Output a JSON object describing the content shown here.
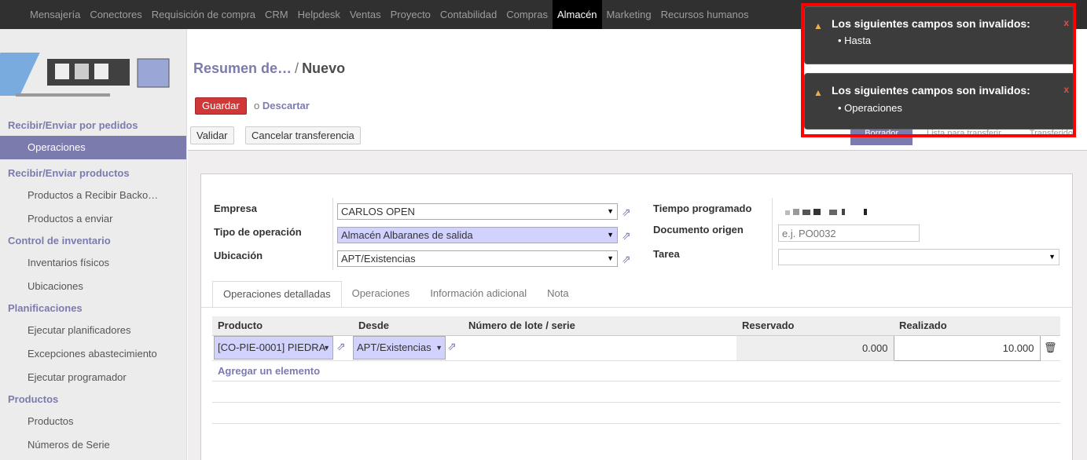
{
  "topbar": {
    "items": [
      "Mensajería",
      "Conectores",
      "Requisición de compra",
      "CRM",
      "Helpdesk",
      "Ventas",
      "Proyecto",
      "Contabilidad",
      "Compras",
      "Almacén",
      "Marketing",
      "Recursos humanos"
    ],
    "active": "Almacén"
  },
  "sidebar": {
    "sections": [
      {
        "title": "Recibir/Enviar por pedidos",
        "items": [
          "Operaciones"
        ]
      },
      {
        "title": "Recibir/Enviar productos",
        "items": [
          "Productos a Recibir Backo…",
          "Productos a enviar"
        ]
      },
      {
        "title": "Control de inventario",
        "items": [
          "Inventarios físicos",
          "Ubicaciones"
        ]
      },
      {
        "title": "Planificaciones",
        "items": [
          "Ejecutar planificadores",
          "Excepciones abastecimiento",
          "Ejecutar programador"
        ]
      },
      {
        "title": "Productos",
        "items": [
          "Productos",
          "Números de Serie"
        ]
      }
    ],
    "active_item": "Operaciones"
  },
  "breadcrumb": {
    "parent": "Resumen de…",
    "separator": "/",
    "current": "Nuevo"
  },
  "actions": {
    "save": "Guardar",
    "or": "o",
    "discard": "Descartar",
    "validate": "Validar",
    "cancel_transfer": "Cancelar transferencia"
  },
  "status": {
    "steps": [
      "Borrador",
      "Lista para transferir",
      "Transferido"
    ],
    "current": "Borrador"
  },
  "form": {
    "company_label": "Empresa",
    "company_value": "CARLOS OPEN",
    "op_type_label": "Tipo de operación",
    "op_type_value": "Almacén                Albaranes de salida",
    "location_label": "Ubicación",
    "location_value": "APT/Existencias",
    "scheduled_label": "Tiempo programado",
    "origin_label": "Documento origen",
    "origin_placeholder": "e.j. PO0032",
    "task_label": "Tarea",
    "task_value": ""
  },
  "tabs": [
    "Operaciones detalladas",
    "Operaciones",
    "Información adicional",
    "Nota"
  ],
  "active_tab": "Operaciones detalladas",
  "table": {
    "headers": {
      "product": "Producto",
      "from": "Desde",
      "lot": "Número de lote / serie",
      "reserved": "Reservado",
      "done": "Realizado"
    },
    "row": {
      "product": "[CO-PIE-0001] PIEDRA",
      "from": "APT/Existencias",
      "lot": "",
      "reserved": "0.000",
      "done": "10.000"
    },
    "add_line": "Agregar un elemento"
  },
  "notifications": [
    {
      "title": "Los siguientes campos son invalidos:",
      "fields": [
        "Hasta"
      ]
    },
    {
      "title": "Los siguientes campos son invalidos:",
      "fields": [
        "Operaciones"
      ]
    }
  ],
  "colors": {
    "brand": "#7c7bad",
    "danger": "#d03838",
    "topbar": "#303030",
    "highlight": "#ff0000"
  }
}
